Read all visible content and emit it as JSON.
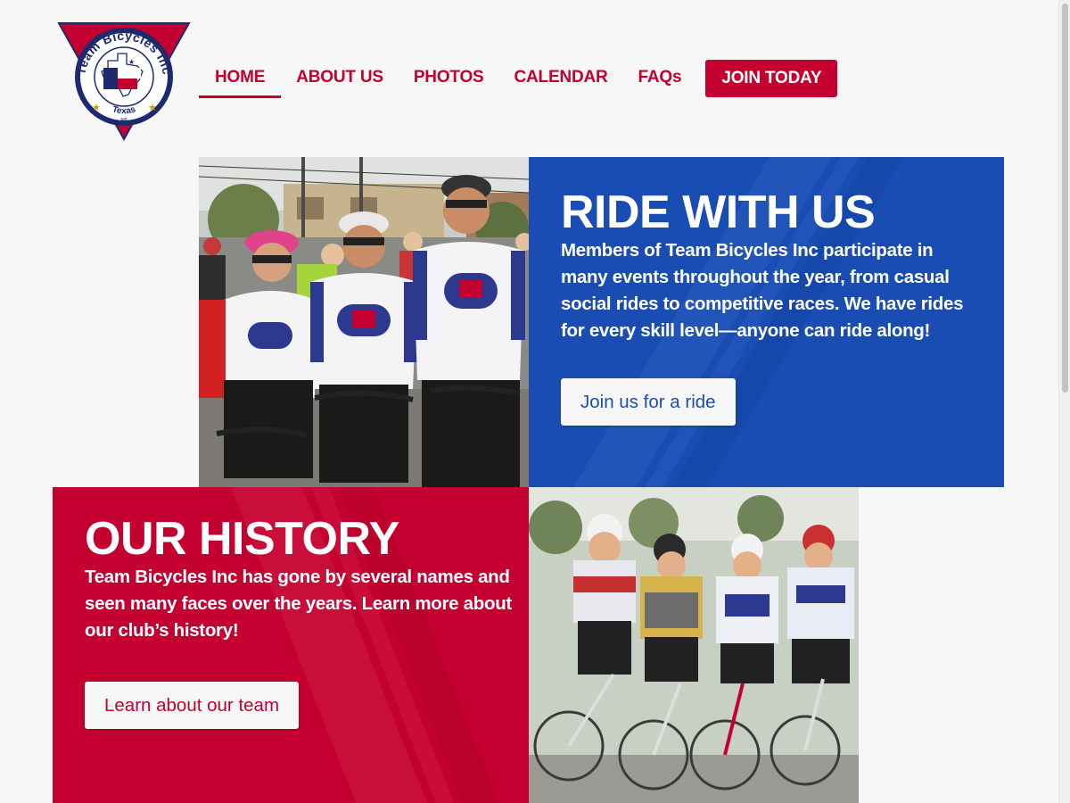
{
  "brand": {
    "logo_name": "Team Bicycles Inc",
    "logo_region": "Texas",
    "logo_number": "86",
    "colors": {
      "red": "#c3002f",
      "blue": "#1a4db4",
      "navy": "#1d2a6e"
    }
  },
  "nav": {
    "items": [
      {
        "label": "HOME",
        "active": true
      },
      {
        "label": "ABOUT US"
      },
      {
        "label": "PHOTOS"
      },
      {
        "label": "CALENDAR"
      },
      {
        "label": "FAQs"
      }
    ],
    "join_label": "JOIN TODAY"
  },
  "ride_section": {
    "title": "RIDE WITH US",
    "text": "Members of Team Bicycles Inc participate in many events throughout the year, from casual social rides to competitive races. We have rides for every skill level—anyone can ride along!",
    "button_label": "Join us for a ride",
    "photo_icon": "group-of-cyclists-photo"
  },
  "history_section": {
    "title": "OUR HISTORY",
    "text": "Team Bicycles Inc has gone by several names and seen many faces over the years. Learn more about our club’s history!",
    "button_label": "Learn about our team",
    "photo_icon": "vintage-race-start-photo"
  }
}
